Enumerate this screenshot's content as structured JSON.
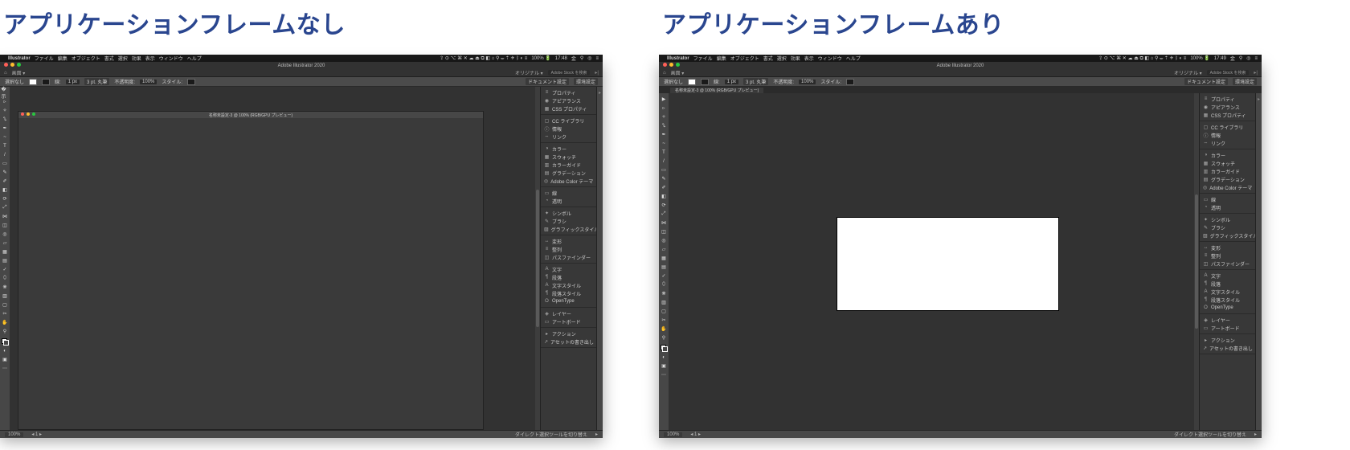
{
  "headings": {
    "left": "アプリケーションフレームなし",
    "right": "アプリケーションフレームあり"
  },
  "menubar": {
    "app_name": "Illustrator",
    "menus": [
      "ファイル",
      "編集",
      "オブジェクト",
      "書式",
      "選択",
      "効果",
      "表示",
      "ウィンドウ",
      "ヘルプ"
    ],
    "status_text_left": "100% 🔋",
    "time_left": "17:48",
    "time_right": "17:49",
    "date_suffix": "金"
  },
  "titlebar": {
    "title": "Adobe Illustrator 2020"
  },
  "subbar": {
    "home": "⌂",
    "label": "画面 ▾",
    "right_label1": "オリジナル ▾",
    "right_label2": "Adobe Stock を検索",
    "arrows": "▸|"
  },
  "controlbar": {
    "sel": "選択なし",
    "stroke_label": "線:",
    "stroke_val": "1 px",
    "brush_label": "3 pt. 丸筆",
    "opacity_label": "不透明度:",
    "opacity_val": "100%",
    "style_label": "スタイル:",
    "docset_label": "ドキュメント設定",
    "prefs_label": "環境設定"
  },
  "document": {
    "tab_title": "名称未設定-3 @ 100% (RGB/GPU プレビュー)"
  },
  "panels": {
    "g1": [
      {
        "icon": "≡",
        "label": "プロパティ"
      },
      {
        "icon": "◉",
        "label": "アピアランス"
      },
      {
        "icon": "▦",
        "label": "CSS プロパティ"
      }
    ],
    "g2": [
      {
        "icon": "▢",
        "label": "CC ライブラリ"
      },
      {
        "icon": "ⓘ",
        "label": "情報"
      },
      {
        "icon": "⇔",
        "label": "リンク"
      }
    ],
    "g3": [
      {
        "icon": "◑",
        "label": "カラー"
      },
      {
        "icon": "▦",
        "label": "スウォッチ"
      },
      {
        "icon": "▥",
        "label": "カラーガイド"
      },
      {
        "icon": "▤",
        "label": "グラデーション"
      },
      {
        "icon": "◎",
        "label": "Adobe Color テーマ"
      }
    ],
    "g4": [
      {
        "icon": "▭",
        "label": "線"
      },
      {
        "icon": "◔",
        "label": "透明"
      }
    ],
    "g5": [
      {
        "icon": "✦",
        "label": "シンボル"
      },
      {
        "icon": "✎",
        "label": "ブラシ"
      },
      {
        "icon": "▨",
        "label": "グラフィックスタイル"
      }
    ],
    "g6": [
      {
        "icon": "↔",
        "label": "変形"
      },
      {
        "icon": "≡",
        "label": "整列"
      },
      {
        "icon": "◫",
        "label": "パスファインダー"
      }
    ],
    "g7": [
      {
        "icon": "A",
        "label": "文字"
      },
      {
        "icon": "¶",
        "label": "段落"
      },
      {
        "icon": "A",
        "label": "文字スタイル"
      },
      {
        "icon": "¶",
        "label": "段落スタイル"
      },
      {
        "icon": "O",
        "label": "OpenType"
      }
    ],
    "g8": [
      {
        "icon": "◈",
        "label": "レイヤー"
      },
      {
        "icon": "▭",
        "label": "アートボード"
      }
    ],
    "g9": [
      {
        "icon": "▸",
        "label": "アクション"
      },
      {
        "icon": "↗",
        "label": "アセットの書き出し"
      }
    ]
  },
  "statusbar": {
    "zoom": "100%",
    "hint": "ダイレクト選択ツールを切り替え"
  }
}
